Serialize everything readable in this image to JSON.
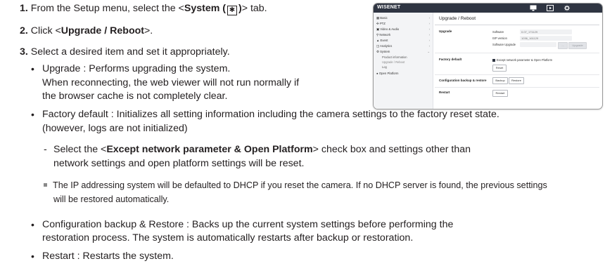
{
  "steps": [
    {
      "num": "1.",
      "pre": "From the Setup menu, select the <",
      "bold": "System (",
      "bold_after": ")",
      "post": "> tab."
    },
    {
      "num": "2.",
      "pre": "Click <",
      "bold": "Upgrade / Reboot",
      "post": ">."
    },
    {
      "num": "3.",
      "text": "Select a desired item and set it appropriately."
    }
  ],
  "bullets": {
    "upgrade": [
      "Upgrade : Performs upgrading the system.",
      "When reconnecting, the web viewer will not run normally if",
      "the browser cache is not completely clear."
    ],
    "factory": [
      "Factory default : Initializes all setting information including the camera settings to the factory reset state.",
      "(however, logs are not initialized)"
    ],
    "select": {
      "pre": "Select the <",
      "bold": "Except network parameter & Open Platform",
      "post": "> check box and settings other than",
      "line2": "network settings and open platform settings will be reset."
    },
    "note": [
      "The IP addressing system will be defaulted to DHCP if you reset the camera. If no DHCP server is found, the previous settings",
      "will be restored automatically."
    ],
    "backup": [
      "Configuration backup & Restore : Backs up the current system settings before performing the",
      "restoration process. The system is automatically restarts after backup or restoration."
    ],
    "restart": "Restart : Restarts the system."
  },
  "screenshot": {
    "logo": "WISENET",
    "page_title": "Upgrade / Reboot",
    "sidebar": [
      {
        "label": "Basic",
        "icon": "grid-icon"
      },
      {
        "label": "PTZ",
        "icon": "ptz-icon"
      },
      {
        "label": "Video & Audio",
        "icon": "video-icon"
      },
      {
        "label": "Network",
        "icon": "network-icon"
      },
      {
        "label": "Event",
        "icon": "event-icon"
      },
      {
        "label": "Analytics",
        "icon": "analytics-icon"
      },
      {
        "label": "System",
        "icon": "system-icon"
      }
    ],
    "system_sub": [
      "Product information",
      "Upgrade / Reboot",
      "Log"
    ],
    "open_platform": "Open Platform",
    "upgrade_section": "Upgrade",
    "software_label": "Software",
    "software_value": "0.07_171129",
    "isp_label": "ISP version",
    "isp_value": "1036_161129",
    "sw_upgrade_label": "Software Upgrade",
    "browse_btn": "...",
    "upgrade_btn": "Upgrade",
    "factory_section": "Factory default",
    "except_label": "Except network parameter & Open Platform",
    "reset_btn": "Reset",
    "backup_section": "Configuration backup & restore",
    "backup_btn": "Backup",
    "restore_btn": "Restore",
    "restart_section": "Restart",
    "restart_btn": "Restart"
  }
}
